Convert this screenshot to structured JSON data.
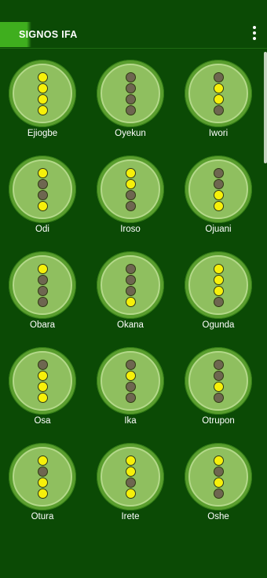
{
  "appbar": {
    "title": "SIGNOS IFA",
    "menu_icon": "more-vert-icon",
    "accent": "#3fae1e"
  },
  "colors": {
    "background": "#0b4a05",
    "bead_on": "#f6f00a",
    "bead_off": "#6e6650"
  },
  "signs": [
    {
      "name": "Ejiogbe",
      "beads": [
        1,
        1,
        1,
        1
      ]
    },
    {
      "name": "Oyekun",
      "beads": [
        0,
        0,
        0,
        0
      ]
    },
    {
      "name": "Iwori",
      "beads": [
        0,
        1,
        1,
        0
      ]
    },
    {
      "name": "Odi",
      "beads": [
        1,
        0,
        0,
        1
      ]
    },
    {
      "name": "Iroso",
      "beads": [
        1,
        1,
        0,
        0
      ]
    },
    {
      "name": "Ojuani",
      "beads": [
        0,
        0,
        1,
        1
      ]
    },
    {
      "name": "Obara",
      "beads": [
        1,
        0,
        0,
        0
      ]
    },
    {
      "name": "Okana",
      "beads": [
        0,
        0,
        0,
        1
      ]
    },
    {
      "name": "Ogunda",
      "beads": [
        1,
        1,
        1,
        0
      ]
    },
    {
      "name": "Osa",
      "beads": [
        0,
        1,
        1,
        1
      ]
    },
    {
      "name": "Ika",
      "beads": [
        0,
        1,
        0,
        0
      ]
    },
    {
      "name": "Otrupon",
      "beads": [
        0,
        0,
        1,
        0
      ]
    },
    {
      "name": "Otura",
      "beads": [
        1,
        0,
        1,
        1
      ]
    },
    {
      "name": "Irete",
      "beads": [
        1,
        1,
        0,
        1
      ]
    },
    {
      "name": "Oshe",
      "beads": [
        1,
        0,
        1,
        0
      ]
    }
  ]
}
